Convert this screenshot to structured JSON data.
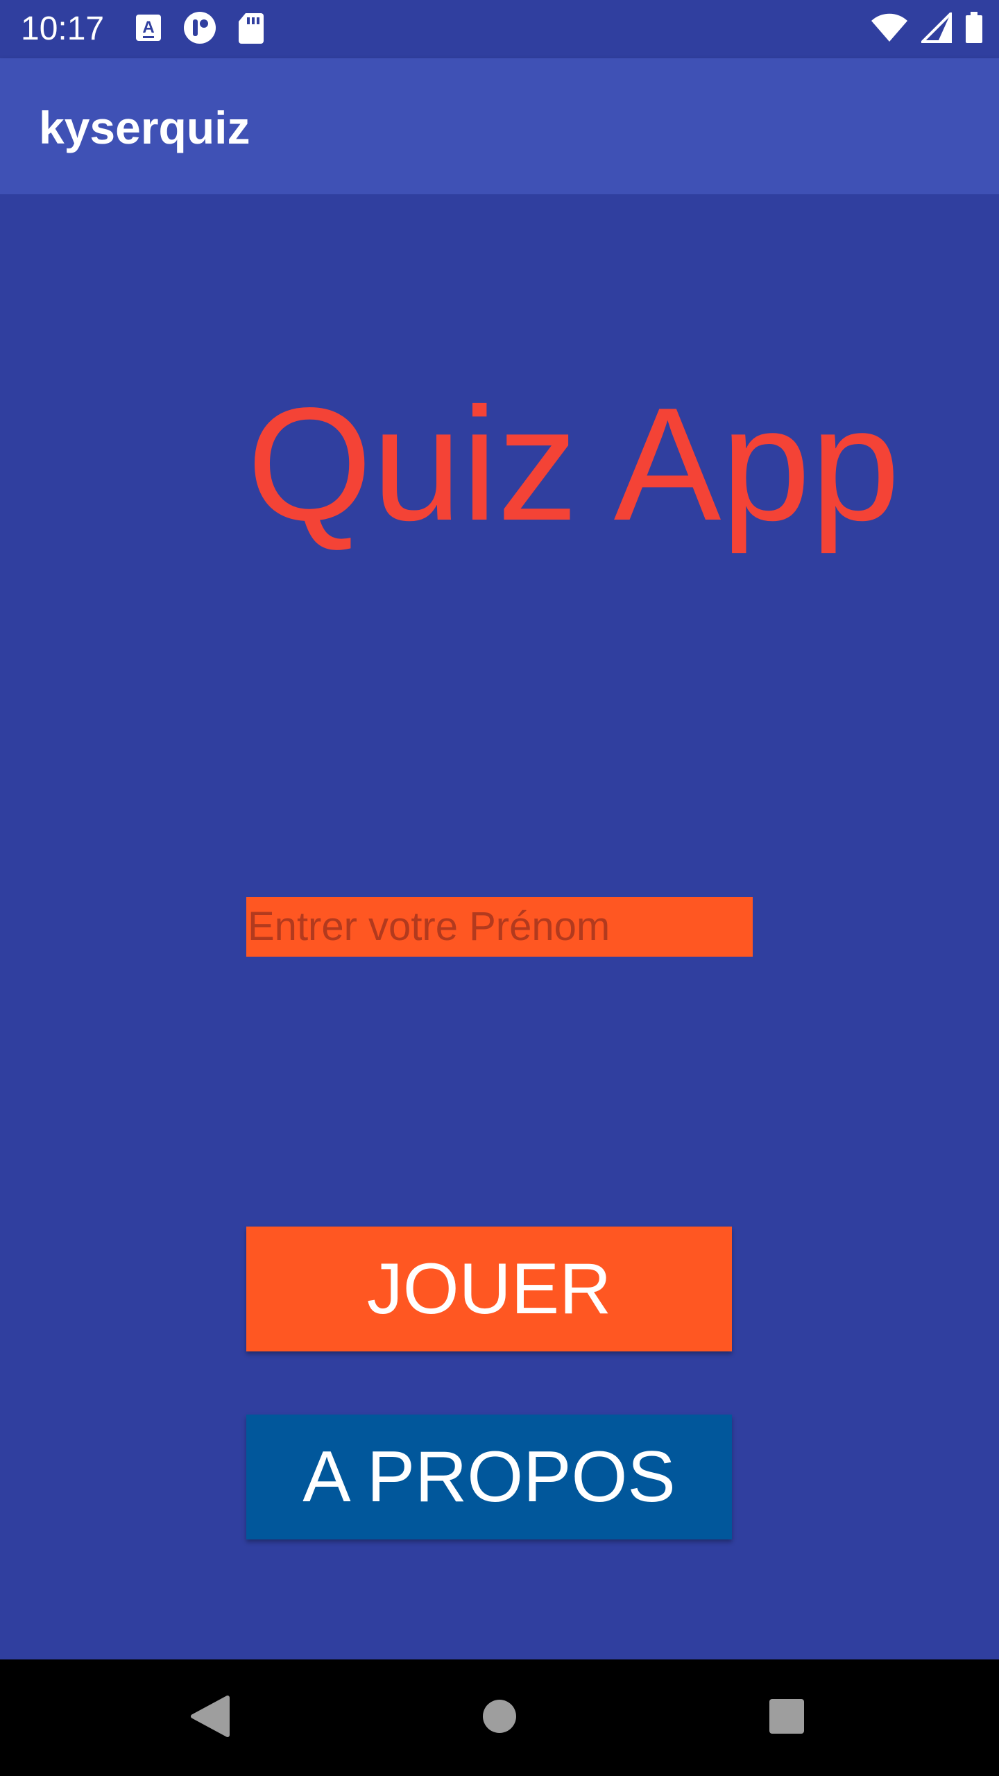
{
  "status_bar": {
    "time": "10:17",
    "icons_left": [
      "keyboard-a-icon",
      "circle-notification-icon",
      "sd-card-icon"
    ],
    "icons_right": [
      "wifi-icon",
      "cell-signal-icon",
      "battery-icon"
    ]
  },
  "app_bar": {
    "title": "kyserquiz"
  },
  "main": {
    "heading": "Quiz App",
    "name_input": {
      "placeholder": "Entrer votre Prénom",
      "value": ""
    },
    "play_button": "JOUER",
    "about_button": "A PROPOS"
  },
  "nav_bar": {
    "icons": [
      "back-icon",
      "home-icon",
      "recents-icon"
    ]
  },
  "colors": {
    "status_bar": "#303F9F",
    "app_bar": "#3F51B5",
    "background": "#303F9F",
    "heading": "#F44336",
    "input_background": "#FF5722",
    "play_button": "#FF5722",
    "about_button": "#01579B",
    "nav_bar": "#000000"
  }
}
